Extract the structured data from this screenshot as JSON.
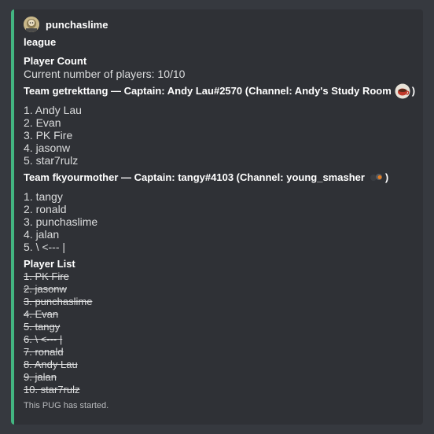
{
  "embed": {
    "accent_color": "#43b581",
    "author": {
      "name": "punchaslime",
      "avatar_icon": "avatar-image"
    },
    "title": "league",
    "fields": {
      "player_count": {
        "name": "Player Count",
        "value": "Current number of players: 10/10"
      },
      "team1": {
        "name_prefix": "Team getrekttang — Captain: Andy Lau#2570 (Channel: Andy's Study Room",
        "name_suffix": ")",
        "emoji": "coffee-cup-icon",
        "members": [
          "1. Andy Lau",
          "2. Evan",
          "3. PK Fire",
          "4. jasonw",
          "5. star7rulz"
        ]
      },
      "team2": {
        "name_prefix": "Team fkyourmother — Captain: tangy#4103 (Channel: young_smasher",
        "name_suffix": ")",
        "emoji": "ping-pong-icon",
        "members": [
          "1. tangy",
          "2. ronald",
          "3. punchaslime",
          "4. jalan",
          "5. \\ <--- |"
        ]
      },
      "player_list": {
        "name": "Player List",
        "entries": [
          "1. PK Fire",
          "2. jasonw",
          "3. punchaslime",
          "4. Evan",
          "5. tangy",
          "6. \\ <--- |",
          "7. ronald",
          "8. Andy Lau",
          "9. jalan",
          "10. star7rulz"
        ]
      }
    },
    "footer": "This PUG has started."
  }
}
